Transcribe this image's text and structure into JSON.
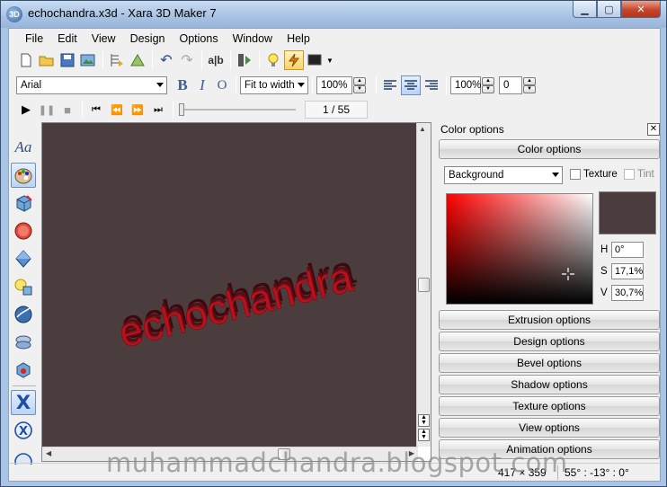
{
  "window": {
    "title": "echochandra.x3d - Xara 3D Maker 7",
    "icon_text": "3D"
  },
  "menu": [
    "File",
    "Edit",
    "View",
    "Design",
    "Options",
    "Window",
    "Help"
  ],
  "toolbar2": {
    "font": "Arial",
    "fit": "Fit to width",
    "size": "100%",
    "spacing": "100%",
    "offset": "0"
  },
  "playback": {
    "frame": "1 / 55"
  },
  "canvas": {
    "text": "echochandra",
    "bg": "#4b3d3e",
    "text_color": "#b8101c"
  },
  "panel": {
    "title": "Color options",
    "section_open": "Color options",
    "target": "Background",
    "texture_label": "Texture",
    "tint_label": "Tint",
    "swatch_color": "#4b3d3e",
    "h_label": "H",
    "h_value": "0°",
    "s_label": "S",
    "s_value": "17,1%",
    "v_label": "V",
    "v_value": "30,7%",
    "sections": [
      "Extrusion options",
      "Design options",
      "Bevel options",
      "Shadow options",
      "Texture options",
      "View options",
      "Animation options"
    ]
  },
  "status": {
    "size": "417 × 359",
    "angles": "55° : -13° : 0°"
  },
  "watermark": "muhammadchandra.blogspot.com"
}
